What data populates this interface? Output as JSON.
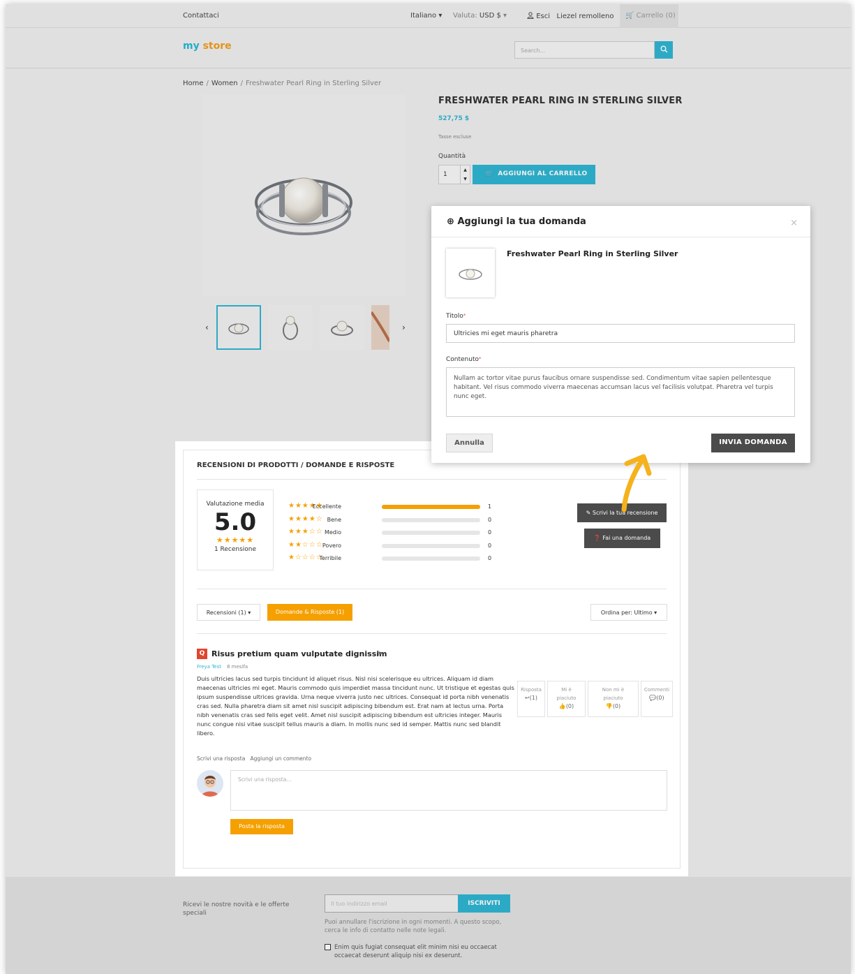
{
  "header": {
    "contact": "Contattaci",
    "language": "Italiano",
    "currency_label": "Valuta:",
    "currency_value": "USD $",
    "logout": "Esci",
    "user_name": "Liezel remolleno",
    "cart": "Carrello (0)",
    "logo_part1": "my",
    "logo_part2": "store",
    "search_placeholder": "Search..."
  },
  "breadcrumb": {
    "home": "Home",
    "category": "Women",
    "current": "Freshwater Pearl Ring in Sterling Silver"
  },
  "product": {
    "title": "FRESHWATER PEARL RING IN STERLING SILVER",
    "price": "527,75 $",
    "tax_note": "Tasse escluse",
    "quantity_label": "Quantità",
    "quantity_value": "1",
    "add_to_cart": "AGGIUNGI AL CARRELLO"
  },
  "reviews": {
    "heading": "RECENSIONI DI PRODOTTI / DOMANDE E RISPOSTE",
    "average_label": "Valutazione media",
    "average_value": "5.0",
    "review_count": "1 Recensione",
    "distribution": [
      {
        "label": "Eccellente",
        "stars": 5,
        "count": "1",
        "fraction": 1.0
      },
      {
        "label": "Bene",
        "stars": 4,
        "count": "0",
        "fraction": 0
      },
      {
        "label": "Medio",
        "stars": 3,
        "count": "0",
        "fraction": 0
      },
      {
        "label": "Povero",
        "stars": 2,
        "count": "0",
        "fraction": 0
      },
      {
        "label": "Terribile",
        "stars": 1,
        "count": "0",
        "fraction": 0
      }
    ],
    "write_review": "Scrivi la tua recensione",
    "ask_question": "Fai una domanda",
    "tab_reviews": "Recensioni (1)",
    "tab_qa": "Domande & Risposte (1)",
    "sort": "Ordina per: Ultimo"
  },
  "question": {
    "badge": "Q",
    "title": "Risus pretium quam vulputate dignissim",
    "author": "Freya Test",
    "date": "8 mesifa",
    "body": "Duis ultricies lacus sed turpis tincidunt id aliquet risus. Nisl nisi scelerisque eu ultrices. Aliquam id diam maecenas ultricies mi eget. Mauris commodo quis imperdiet massa tincidunt nunc. Ut tristique et egestas quis ipsum suspendisse ultrices gravida. Urna neque viverra justo nec ultrices. Consequat id porta nibh venenatis cras sed. Nulla pharetra diam sit amet nisl suscipit adipiscing bibendum est. Erat nam at lectus urna. Porta nibh venenatis cras sed felis eget velit. Amet nisl suscipit adipiscing bibendum est ultricies integer. Mauris nunc congue nisi vitae suscipit tellus mauris a diam. In mollis nunc sed id semper. Mattis nunc sed blandit libero.",
    "link_answer": "Scrivi una risposta",
    "link_comment": "Aggiungi un commento",
    "stat_answer_label": "Risposta",
    "stat_answer_value": "(1)",
    "stat_like_label1": "Mi è",
    "stat_like_label2": "piaciuto",
    "stat_like_value": "(0)",
    "stat_dislike_label1": "Non mi è",
    "stat_dislike_label2": "piaciuto",
    "stat_dislike_value": "(0)",
    "stat_comment_label": "Commenti",
    "stat_comment_value": "(0)",
    "reply_placeholder": "Scrivi una risposta...",
    "reply_button": "Posta la risposta"
  },
  "footer": {
    "newsletter_text": "Ricevi le nostre novità e le offerte speciali",
    "email_placeholder": "Il tuo indirizzo email",
    "subscribe": "ISCRIVITI",
    "note": "Puoi annullare l'iscrizione in ogni momenti. A questo scopo, cerca le info di contatto nelle note legali.",
    "consent": "Enim quis fugiat consequat elit minim nisi eu occaecat occaecat deserunt aliquip nisi ex deserunt."
  },
  "modal": {
    "title": "Aggiungi la tua domanda",
    "product_name": "Freshwater Pearl Ring in Sterling Silver",
    "title_label": "Titolo",
    "title_value": "Ultricies mi eget mauris pharetra",
    "content_label": "Contenuto",
    "content_value": "Nullam ac tortor vitae purus faucibus ornare suspendisse sed. Condimentum vitae sapien pellentesque habitant. Vel risus commodo viverra maecenas accumsan lacus vel facilisis volutpat. Pharetra vel turpis nunc eget.",
    "cancel": "Annulla",
    "submit": "INVIA DOMANDA",
    "close": "×"
  },
  "colors": {
    "accent_blue": "#2fb5d2",
    "accent_orange": "#f5a000",
    "dark_button": "#4b4b4b",
    "annotation_arrow": "#f5b21b"
  }
}
